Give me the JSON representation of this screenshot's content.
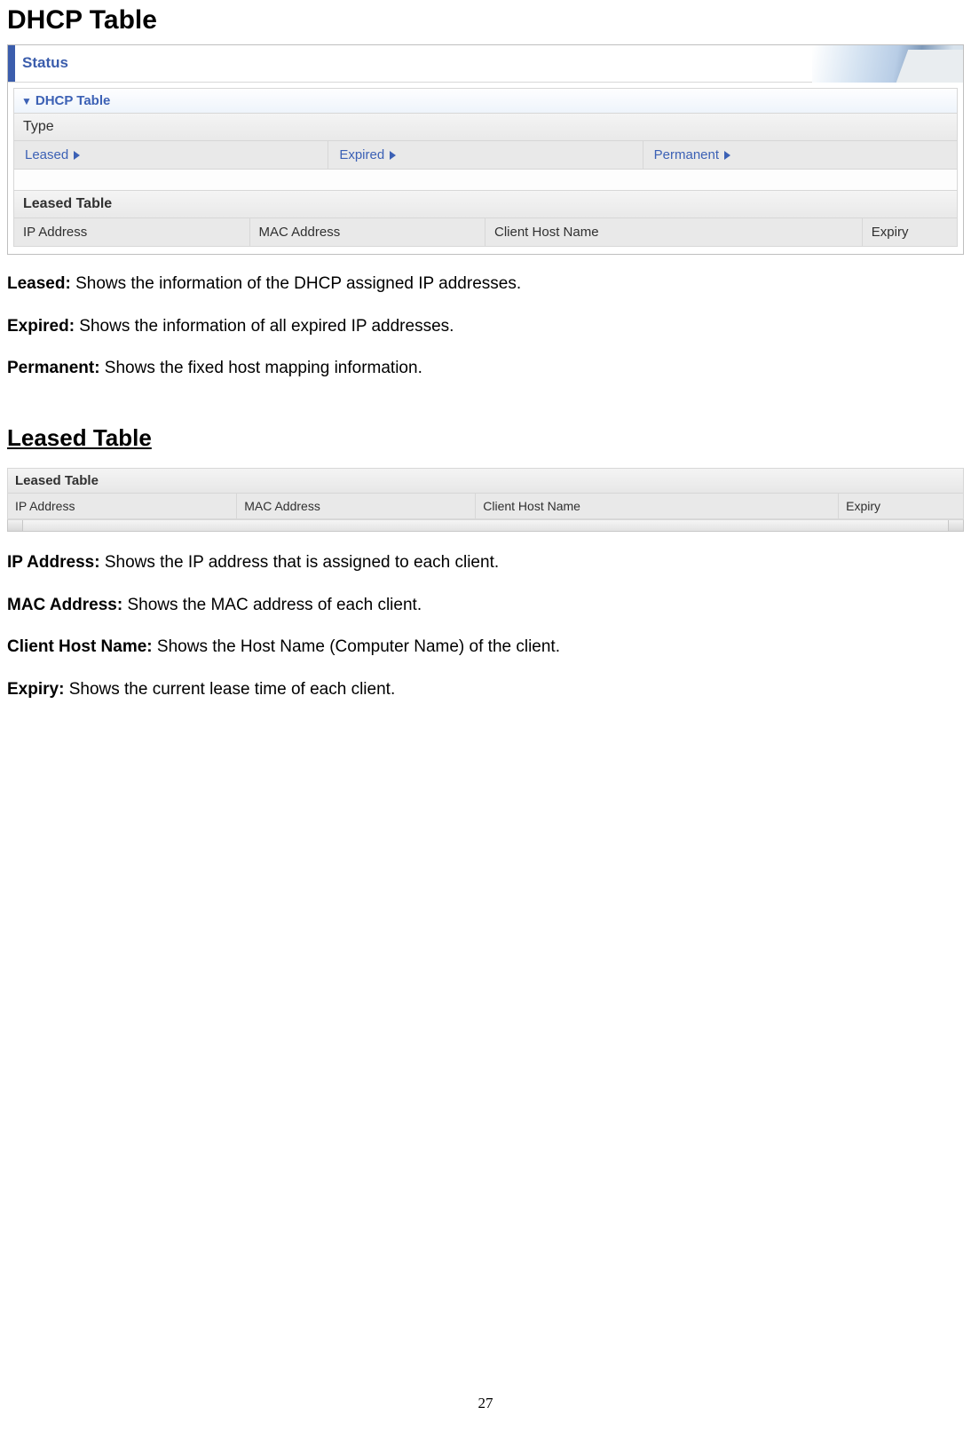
{
  "headings": {
    "main": "DHCP Table",
    "leased": "Leased Table "
  },
  "figure1": {
    "status_label": "Status",
    "panel_title": "DHCP Table",
    "type_header": "Type",
    "type_options": [
      "Leased",
      "Expired",
      "Permanent"
    ],
    "leased_table_title": "Leased Table",
    "columns": [
      "IP Address",
      "MAC Address",
      "Client Host Name",
      "Expiry"
    ]
  },
  "desc1": [
    {
      "term": "Leased:",
      "text": " Shows the information of the DHCP assigned IP addresses."
    },
    {
      "term": "Expired:",
      "text": " Shows the information of all expired IP addresses."
    },
    {
      "term": "Permanent:",
      "text": " Shows the fixed host mapping information."
    }
  ],
  "figure2": {
    "title": "Leased Table",
    "columns": [
      "IP Address",
      "MAC Address",
      "Client Host Name",
      "Expiry"
    ]
  },
  "desc2": [
    {
      "term": "IP Address:",
      "text": " Shows the IP address that is assigned to each client."
    },
    {
      "term": "MAC Address:",
      "text": " Shows the MAC address of each client."
    },
    {
      "term": "Client Host Name:",
      "text": " Shows the Host Name (Computer Name) of the client."
    },
    {
      "term": "Expiry:",
      "text": " Shows the current lease time of each client."
    }
  ],
  "page_number": "27"
}
